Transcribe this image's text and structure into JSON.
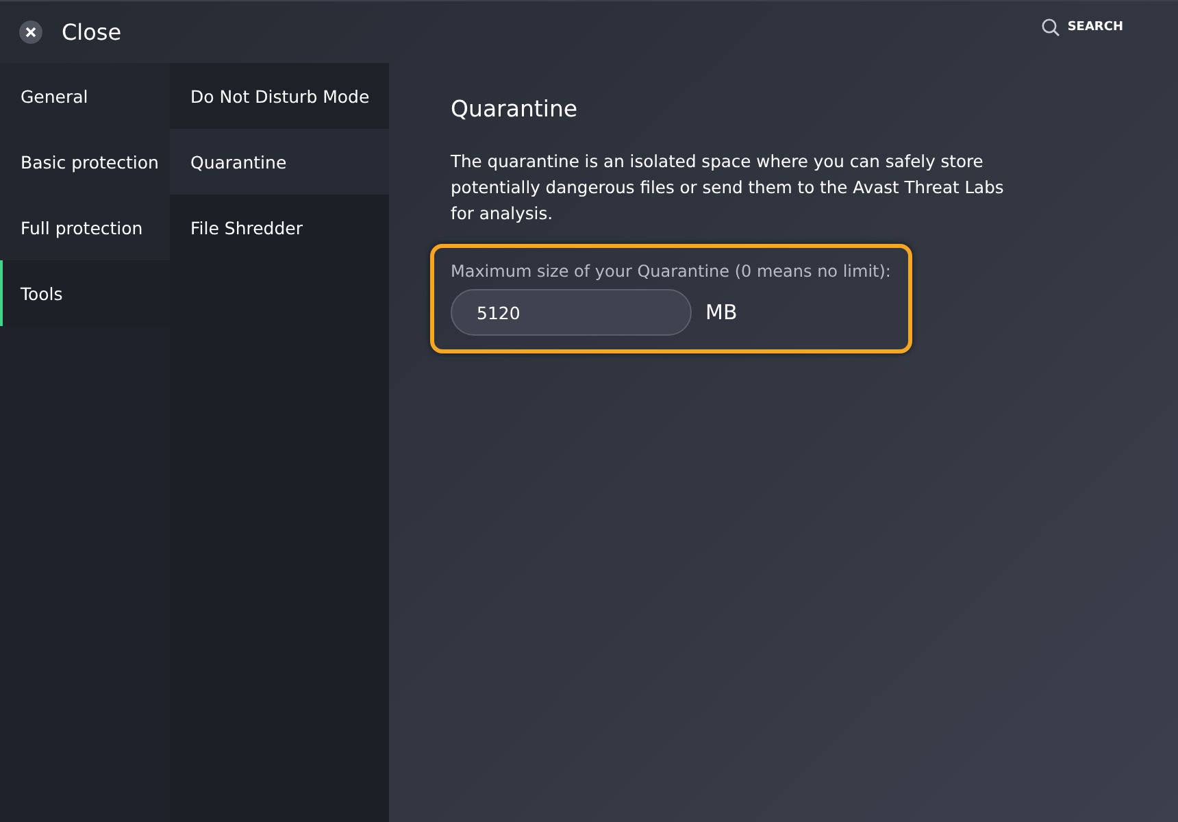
{
  "header": {
    "close_label": "Close",
    "search_label": "SEARCH"
  },
  "categories": [
    {
      "label": "General",
      "selected": false
    },
    {
      "label": "Basic protection",
      "selected": false
    },
    {
      "label": "Full protection",
      "selected": false
    },
    {
      "label": "Tools",
      "selected": true
    }
  ],
  "subcategories": [
    {
      "label": "Do Not Disturb Mode",
      "selected": false
    },
    {
      "label": "Quarantine",
      "selected": true
    },
    {
      "label": "File Shredder",
      "selected": false
    }
  ],
  "content": {
    "title": "Quarantine",
    "description": "The quarantine is an isolated space where you can safely store potentially dangerous files or send them to the Avast Threat Labs for analysis.",
    "field_label": "Maximum size of your Quarantine (0 means no limit):",
    "value": "5120",
    "unit": "MB",
    "highlighted": true
  }
}
